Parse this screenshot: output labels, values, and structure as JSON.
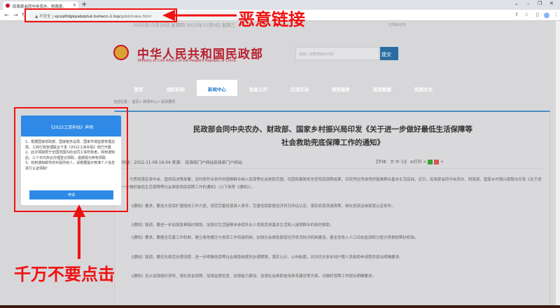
{
  "browser": {
    "tab_title": "民政部会同中央农办、财政部、",
    "url_security": "不安全",
    "url_host": "sjczql0dgkpabzptuk.butiecn-1.top",
    "url_path": "/gzbt/index.html"
  },
  "page": {
    "dateline": "2022年12月29日 星期四 2022年11月9日 星期三",
    "accessibility": "无障碍浏览",
    "site_name": "中华人民共和国民政部",
    "site_name_en": "Ministry of Civil Affairs of the People's Republic of China",
    "search_placeholder": "请输入您要搜索的内容",
    "search_button": "提交",
    "nav": [
      "首页",
      "组织机构",
      "新闻中心",
      "信息公开",
      "交流互动",
      "政务服务",
      "民政数据",
      "民政文化"
    ],
    "active_nav": "新闻中心",
    "breadcrumb": "当前位置： 首页> 新闻中心> 民政要闻",
    "article": {
      "title_line1": "民政部会同中央农办、财政部、国家乡村振兴局印发《关于进一步做好最低生活保障等",
      "title_line2": "社会救助兜底保障工作的通知》",
      "meta": "时间：2022-11-08 16:04   来源：  民政部门户网站民政部门户网站",
      "font_label": "【字体：大 中 小】",
      "print_label": "打印",
      "paragraphs": [
        "为贯彻落实党中央、国务院决策部署，及时将符合条件的困难群众纳入低保等社会救助范围，巩固拓展脱贫攻坚兜底保障成果，切实兜住兜准兜好困难群众基本生活底线，近日，民政部会同中央农办、财政部、国家乡村振兴局联合印发《关于进一步做好最低生活保障等社会救助兜底保障工作的通知》（以下简称《通知》）。",
        "《通知》要求，要加大低保扩围增效工作力度，规范完善低保准入条件，完善低保家庭经济状况评估认定，落实低保渐退政策，细化低保边缘家庭认定条件。",
        "《通知》强调，要进一步加强急难临时救助，加强对生活困难未参保失业人员和其他基本生活陷入困境群众的临时救助。",
        "《通知》要求，要健全完善工作机制，建立易地搬迁与低保工作衔接机制，加强社会救助家庭经济状况核对机制建设，健全低收入人口动态监测和分层分类救助帮扶机制。",
        "《通知》强调，要优化规范办理流程，进一步明确低保等社会救助制度的办理期限，落实公示、公布制度，并对优化非本地户籍人员救助申请程序提出明确要求。",
        "《通知》还从加强组织领导、强化资金保障、加强监督检查、加强能力建设、加强社会救助信用体系建设等方面，对做好保障工作提出明确要求。"
      ]
    }
  },
  "popup": {
    "title": "《2022工资补贴》声明",
    "body": "1、根据国家财政部、国家税务总局、国家市场监督管理总局、工商行政管理联合下发《2022工资补贴》现已开展\n2、此次领取限于全国范围内的合同工资所有者，收到通知后，三个日内务必办理登记领取，逾期视为弃权领取\n3、收到通知邮件的补贴所有人，请根据提示核准个人信息进行认证领取!",
    "button": "申请"
  },
  "annotations": {
    "link_warning": "恶意链接",
    "click_warning": "千万不要点击",
    "color": "#f01010"
  }
}
